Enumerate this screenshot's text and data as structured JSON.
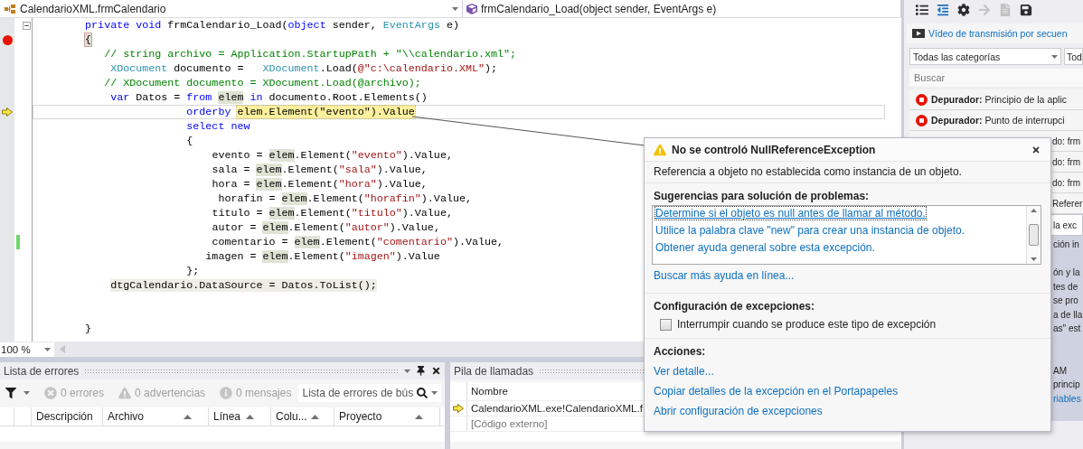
{
  "navigation": {
    "class_selector": "CalendarioXML.frmCalendario",
    "member_selector": "frmCalendario_Load(object sender, EventArgs e)"
  },
  "editor": {
    "lines": [
      {
        "kind": "code",
        "expanded": true,
        "breakpoint": false,
        "current": false,
        "changed": false,
        "tokens": [
          {
            "kind": "keyword",
            "text": "        private"
          },
          {
            "kind": "keyword",
            "text": " void"
          },
          {
            "kind": "plain",
            "text": " frmCalendario_Load("
          },
          {
            "kind": "keyword",
            "text": "object"
          },
          {
            "kind": "plain",
            "text": " sender, "
          },
          {
            "kind": "type",
            "text": "EventArgs"
          },
          {
            "kind": "plain",
            "text": " e)"
          }
        ]
      },
      {
        "kind": "code",
        "breakpoint": true,
        "current": false,
        "changed": false,
        "tokens": [
          {
            "kind": "brace",
            "text": "        {"
          }
        ]
      },
      {
        "kind": "code",
        "breakpoint": false,
        "current": false,
        "changed": false,
        "tokens": [
          {
            "kind": "comment",
            "text": "           // string archivo = Application.StartupPath + \"\\\\calendario.xml\";"
          }
        ]
      },
      {
        "kind": "code",
        "breakpoint": false,
        "current": false,
        "changed": false,
        "tokens": [
          {
            "kind": "type",
            "text": "            XDocument"
          },
          {
            "kind": "plain",
            "text": " documento =   "
          },
          {
            "kind": "type",
            "text": "XDocument"
          },
          {
            "kind": "plain",
            "text": ".Load("
          },
          {
            "kind": "string",
            "text": "@\"c:\\calendario.XML\""
          },
          {
            "kind": "plain",
            "text": ");"
          }
        ]
      },
      {
        "kind": "code",
        "breakpoint": false,
        "current": false,
        "changed": false,
        "tokens": [
          {
            "kind": "comment",
            "text": "           // XDocument documento = XDocument.Load(@archivo);"
          }
        ]
      },
      {
        "kind": "code",
        "breakpoint": false,
        "current": false,
        "changed": false,
        "tokens": [
          {
            "kind": "keyword",
            "text": "            var"
          },
          {
            "kind": "plain",
            "text": " Datos = "
          },
          {
            "kind": "keyword",
            "text": "from "
          },
          {
            "kind": "reference",
            "text": "elem"
          },
          {
            "kind": "keyword",
            "text": " in"
          },
          {
            "kind": "plain",
            "text": " documento.Root.Elements()"
          }
        ]
      },
      {
        "kind": "code",
        "breakpoint": false,
        "current": true,
        "changed": false,
        "tokens": [
          {
            "kind": "keyword",
            "text": "                        orderby "
          },
          {
            "kind": "current",
            "text": "elem.Element(\"evento\").Value"
          }
        ]
      },
      {
        "kind": "code",
        "breakpoint": false,
        "current": false,
        "changed": false,
        "tokens": [
          {
            "kind": "keyword",
            "text": "                        select new"
          }
        ]
      },
      {
        "kind": "code",
        "breakpoint": false,
        "current": false,
        "changed": false,
        "tokens": [
          {
            "kind": "plain",
            "text": "                        {"
          }
        ]
      },
      {
        "kind": "code",
        "breakpoint": false,
        "current": false,
        "changed": false,
        "tokens": [
          {
            "kind": "plain",
            "text": "                            evento = "
          },
          {
            "kind": "reference",
            "text": "elem"
          },
          {
            "kind": "plain",
            "text": ".Element("
          },
          {
            "kind": "string",
            "text": "\"evento\""
          },
          {
            "kind": "plain",
            "text": ").Value,"
          }
        ]
      },
      {
        "kind": "code",
        "breakpoint": false,
        "current": false,
        "changed": false,
        "tokens": [
          {
            "kind": "plain",
            "text": "                            sala = "
          },
          {
            "kind": "reference",
            "text": "elem"
          },
          {
            "kind": "plain",
            "text": ".Element("
          },
          {
            "kind": "string",
            "text": "\"sala\""
          },
          {
            "kind": "plain",
            "text": ").Value,"
          }
        ]
      },
      {
        "kind": "code",
        "breakpoint": false,
        "current": false,
        "changed": false,
        "tokens": [
          {
            "kind": "plain",
            "text": "                            hora = "
          },
          {
            "kind": "reference",
            "text": "elem"
          },
          {
            "kind": "plain",
            "text": ".Element("
          },
          {
            "kind": "string",
            "text": "\"hora\""
          },
          {
            "kind": "plain",
            "text": ").Value,"
          }
        ]
      },
      {
        "kind": "code",
        "breakpoint": false,
        "current": false,
        "changed": false,
        "tokens": [
          {
            "kind": "plain",
            "text": "                             horafin = "
          },
          {
            "kind": "reference",
            "text": "elem"
          },
          {
            "kind": "plain",
            "text": ".Element("
          },
          {
            "kind": "string",
            "text": "\"horafin\""
          },
          {
            "kind": "plain",
            "text": ").Value,"
          }
        ]
      },
      {
        "kind": "code",
        "breakpoint": false,
        "current": false,
        "changed": false,
        "tokens": [
          {
            "kind": "plain",
            "text": "                            titulo = "
          },
          {
            "kind": "reference",
            "text": "elem"
          },
          {
            "kind": "plain",
            "text": ".Element("
          },
          {
            "kind": "string",
            "text": "\"titulo\""
          },
          {
            "kind": "plain",
            "text": ").Value,"
          }
        ]
      },
      {
        "kind": "code",
        "breakpoint": false,
        "current": false,
        "changed": false,
        "tokens": [
          {
            "kind": "plain",
            "text": "                            autor = "
          },
          {
            "kind": "reference",
            "text": "elem"
          },
          {
            "kind": "plain",
            "text": ".Element("
          },
          {
            "kind": "string",
            "text": "\"autor\""
          },
          {
            "kind": "plain",
            "text": ").Value,"
          }
        ]
      },
      {
        "kind": "code",
        "breakpoint": false,
        "current": false,
        "changed": true,
        "tokens": [
          {
            "kind": "plain",
            "text": "                            comentario = "
          },
          {
            "kind": "reference",
            "text": "elem"
          },
          {
            "kind": "plain",
            "text": ".Element("
          },
          {
            "kind": "string",
            "text": "\"comentario\""
          },
          {
            "kind": "plain",
            "text": ").Value,"
          }
        ]
      },
      {
        "kind": "code",
        "breakpoint": false,
        "current": false,
        "changed": false,
        "tokens": [
          {
            "kind": "plain",
            "text": "                           imagen = "
          },
          {
            "kind": "reference",
            "text": "elem"
          },
          {
            "kind": "plain",
            "text": ".Element("
          },
          {
            "kind": "string",
            "text": "\"imagen\""
          },
          {
            "kind": "plain",
            "text": ").Value"
          }
        ]
      },
      {
        "kind": "code",
        "breakpoint": false,
        "current": false,
        "changed": false,
        "tokens": [
          {
            "kind": "plain",
            "text": "                        };"
          }
        ]
      },
      {
        "kind": "code",
        "breakpoint": false,
        "current": false,
        "changed": false,
        "tokens": [
          {
            "kind": "statement",
            "text": "            dtgCalendario.DataSource = Datos.ToList();"
          }
        ]
      },
      {
        "kind": "blank",
        "breakpoint": false,
        "current": false,
        "changed": false
      },
      {
        "kind": "blank",
        "breakpoint": false,
        "current": false,
        "changed": false
      },
      {
        "kind": "code",
        "breakpoint": false,
        "current": false,
        "changed": false,
        "tokens": [
          {
            "kind": "plain",
            "text": "        }"
          }
        ]
      }
    ],
    "zoom": "100 %"
  },
  "error_list": {
    "title": "Lista de errores",
    "filters": [
      {
        "kind": "error",
        "label": "0 errores",
        "disabled": true
      },
      {
        "kind": "warning",
        "label": "0 advertencias",
        "disabled": true
      },
      {
        "kind": "message",
        "label": "0 mensajes",
        "disabled": true
      }
    ],
    "search": {
      "placeholder": "Lista de errores de bús"
    },
    "columns": [
      {
        "label": "Descripción",
        "sorted": false
      },
      {
        "label": "Archivo",
        "sorted": true
      },
      {
        "label": "Línea",
        "sorted": true
      },
      {
        "label": "Colu...",
        "sorted": true
      },
      {
        "label": "Proyecto",
        "sorted": true
      }
    ]
  },
  "call_stack": {
    "title": "Pila de llamadas",
    "column": "Nombre",
    "rows": [
      {
        "text": "CalendarioXML.exe!CalendarioXML.f",
        "current": true
      },
      {
        "text": "[Código externo]",
        "current": false
      }
    ]
  },
  "diagnostics": {
    "tools": [
      {
        "disabled": false
      },
      {
        "disabled": false
      },
      {
        "disabled": false
      },
      {
        "disabled": true
      },
      {
        "disabled": true
      },
      {
        "disabled": false
      }
    ],
    "video_link": "Vídeo de transmisión por secuen",
    "category_filter": "Todas las categorías",
    "second_filter": "Tod",
    "search": {
      "placeholder": "Buscar"
    },
    "events": [
      {
        "kind": "event",
        "text": "**Depurador:** Principio de la aplic",
        "selected": false
      },
      {
        "kind": "event",
        "text": "**Depurador:** Punto de interrupci",
        "selected": false
      },
      {
        "kind": "covered",
        "text": "do: frm",
        "selected": false
      },
      {
        "kind": "covered",
        "text": "do: frm",
        "selected": false
      },
      {
        "kind": "covered",
        "text": "do: frm",
        "selected": false
      },
      {
        "kind": "covered",
        "text": "Referer",
        "selected": false
      },
      {
        "kind": "covered",
        "text": "la exc",
        "selected": true
      }
    ],
    "detail": [
      {
        "kind": "text",
        "text": "ción in"
      },
      {
        "kind": "gap"
      },
      {
        "kind": "text",
        "text": "ón y la"
      },
      {
        "kind": "text",
        "text": "tes de"
      },
      {
        "kind": "text",
        "text": "se pro"
      },
      {
        "kind": "text",
        "text": "a de lla"
      },
      {
        "kind": "text",
        "text": "as\" est"
      },
      {
        "kind": "gap"
      },
      {
        "kind": "gap"
      },
      {
        "kind": "text",
        "text": "AM"
      },
      {
        "kind": "text",
        "text": "princip"
      },
      {
        "kind": "link",
        "text": "riables"
      }
    ]
  },
  "exception": {
    "title": "No se controló NullReferenceException",
    "message": "Referencia a objeto no establecida como instancia de un objeto.",
    "tips_heading": "Sugerencias para solución de problemas:",
    "tips": [
      {
        "text": "Determine si el objeto es null antes de llamar al método.",
        "selected": true
      },
      {
        "text": "Utilice la palabra clave \"new\" para crear una instancia de objeto.",
        "selected": false
      },
      {
        "text": "Obtener ayuda general sobre esta excepción.",
        "selected": false
      }
    ],
    "more_help": "Buscar más ayuda en línea...",
    "settings_heading": "Configuración de excepciones:",
    "break_option": {
      "label": "Interrumpir cuando se produce este tipo de excepción",
      "checked": false
    },
    "actions_heading": "Acciones:",
    "actions": [
      "Ver detalle...",
      "Copiar detalles de la excepción en el Portapapeles",
      "Abrir configuración de excepciones"
    ]
  }
}
